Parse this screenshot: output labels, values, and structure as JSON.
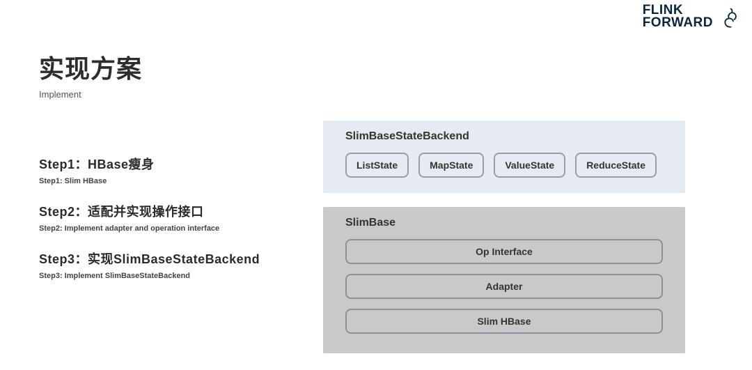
{
  "logo": {
    "line1": "FLINK",
    "line2": "FORWARD"
  },
  "header": {
    "title": "实现方案",
    "subtitle": "Implement"
  },
  "steps": [
    {
      "heading": "Step1：HBase瘦身",
      "sub": "Step1: Slim HBase"
    },
    {
      "heading": "Step2：适配并实现操作接口",
      "sub": "Step2: Implement adapter and operation interface"
    },
    {
      "heading": "Step3：实现SlimBaseStateBackend",
      "sub": "Step3: Implement SlimBaseStateBackend"
    }
  ],
  "diagram": {
    "top": {
      "title": "SlimBaseStateBackend",
      "items": [
        "ListState",
        "MapState",
        "ValueState",
        "ReduceState"
      ]
    },
    "bottom": {
      "title": "SlimBase",
      "items": [
        "Op Interface",
        "Adapter",
        "Slim HBase"
      ]
    }
  }
}
